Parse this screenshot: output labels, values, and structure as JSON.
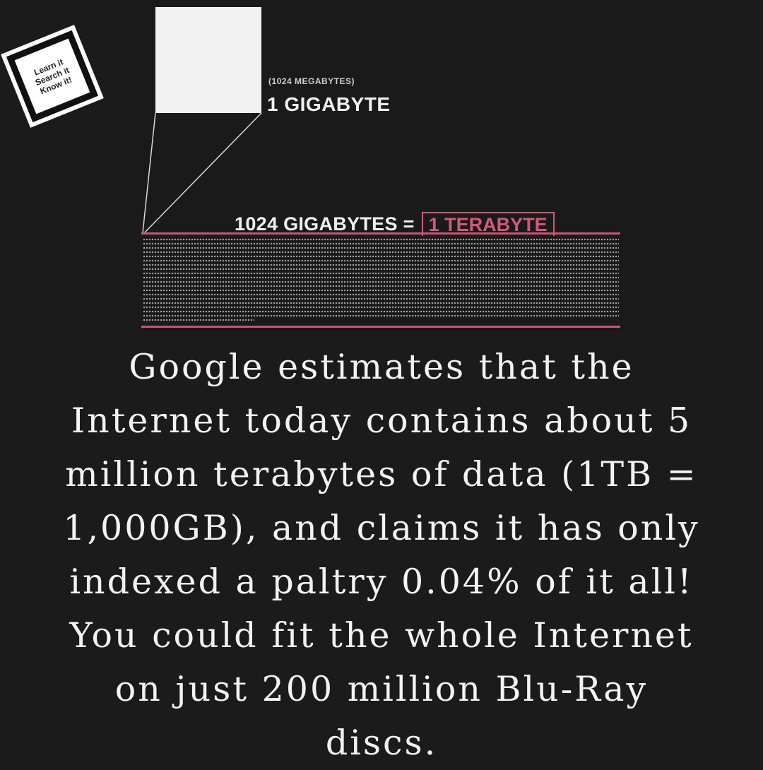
{
  "logo": {
    "lines": [
      "Learn it",
      "Search it",
      "Know it!"
    ]
  },
  "infographic": {
    "gigabyte_sub": "(1024 MEGABYTES)",
    "gigabyte_label": "1 GIGABYTE",
    "equation_left": "1024 GIGABYTES =",
    "equation_right": "1 TERABYTE",
    "accent_color": "#d4587a"
  },
  "caption": {
    "lines": [
      "Google estimates that the",
      "Internet today contains about 5",
      "million terabytes of data (1TB =",
      "1,000GB), and claims it has only",
      "indexed a paltry 0.04% of it all!",
      "You could fit the whole Internet",
      "on just 200 million Blu-Ray",
      "discs."
    ]
  }
}
